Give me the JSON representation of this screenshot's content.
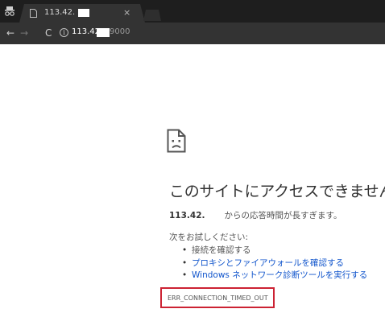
{
  "browser": {
    "tab": {
      "title": "113.42.",
      "close_glyph": "×"
    },
    "toolbar": {
      "back_glyph": "←",
      "forward_glyph": "→",
      "reload_glyph": "C",
      "info_glyph": "i",
      "url_host": "113.42.",
      "url_port": "9000"
    },
    "icons": {
      "incognito": "incognito-icon",
      "tab_page": "page-icon",
      "info": "info-icon",
      "sad_page": "sad-page-icon"
    }
  },
  "error_page": {
    "title": "このサイトにアクセスできません",
    "detail_host": "113.42.",
    "detail_text": "からの応答時間が長すぎます。",
    "suggest_heading": "次をお試しください:",
    "suggestions": [
      "接続を確認する",
      "プロキシとファイアウォールを確認する",
      "Windows ネットワーク診断ツールを実行する"
    ],
    "bullet": "•",
    "error_code": "ERR_CONNECTION_TIMED_OUT",
    "colors": {
      "link": "#1155cc",
      "highlight_box": "#cc2233"
    }
  }
}
